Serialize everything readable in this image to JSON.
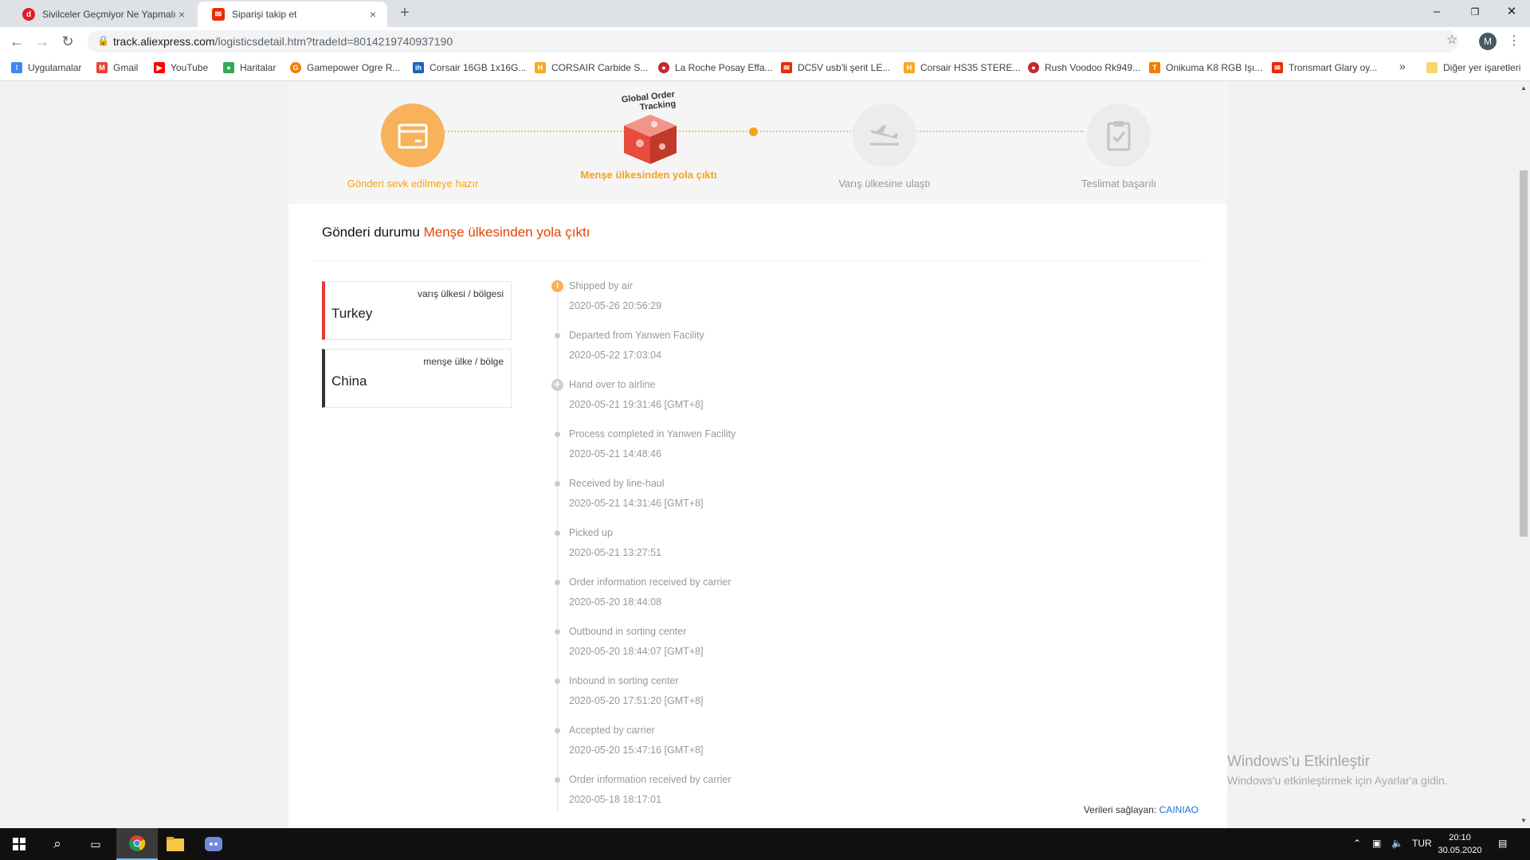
{
  "browser": {
    "tabs": [
      {
        "title": "Sivilceler Geçmiyor Ne Yapmalıyım",
        "close": "×",
        "favicon": "red-circle-icon",
        "color": "#e11c24"
      },
      {
        "title": "Siparişi takip et",
        "close": "×",
        "favicon": "aliexpress-icon",
        "color": "#e62e04"
      }
    ],
    "new_tab": "+",
    "window_controls": {
      "minimize": "–",
      "maximize": "❐",
      "close": "✕"
    },
    "url_host": "track.aliexpress.com",
    "url_path": "/logisticsdetail.htm?tradeId=8014219740937190",
    "profile_initial": "M",
    "bookmarks": [
      {
        "label": "Uygulamalar",
        "icon": "apps-grid-icon",
        "color": "#4285f4"
      },
      {
        "label": "Gmail",
        "icon": "gmail-icon",
        "color": "#ea4335"
      },
      {
        "label": "YouTube",
        "icon": "youtube-icon",
        "color": "#ff0000"
      },
      {
        "label": "Haritalar",
        "icon": "maps-pin-icon",
        "color": "#34a853"
      },
      {
        "label": "Gamepower Ogre R...",
        "icon": "gamepower-icon",
        "color": "#f57c00"
      },
      {
        "label": "Corsair 16GB 1x16G...",
        "icon": "ih-icon",
        "color": "#1565c0"
      },
      {
        "label": "CORSAIR Carbide S...",
        "icon": "hb-icon",
        "color": "#f9a825"
      },
      {
        "label": "La Roche Posay Effa...",
        "icon": "ladybug-icon",
        "color": "#c62828"
      },
      {
        "label": "DC5V usb'li şerit LE...",
        "icon": "aliexpress-icon",
        "color": "#e62e04"
      },
      {
        "label": "Corsair HS35 STERE...",
        "icon": "hb-icon",
        "color": "#f9a825"
      },
      {
        "label": "Rush Voodoo Rk949...",
        "icon": "ladybug-icon",
        "color": "#c62828"
      },
      {
        "label": "Onikuma K8 RGB Işı...",
        "icon": "t-icon",
        "color": "#f57c00"
      },
      {
        "label": "Tronsmart Glary oy...",
        "icon": "aliexpress-icon",
        "color": "#e62e04"
      }
    ],
    "bookmarks_more": "»",
    "other_bookmarks": "Diğer yer işaretleri"
  },
  "tracking": {
    "badge_line1": "Global Order",
    "badge_line2": "Tracking",
    "steps": [
      {
        "label": "Gönderi sevk edilmeye hazır",
        "icon": "package-icon",
        "state": "done"
      },
      {
        "label": "Menşe ülkesinden yola çıktı",
        "icon": "global-order-box-icon",
        "state": "current"
      },
      {
        "label": "Varış ülkesine ulaştı",
        "icon": "plane-landing-icon",
        "state": "pending"
      },
      {
        "label": "Teslimat başarılı",
        "icon": "clipboard-check-icon",
        "state": "pending"
      }
    ],
    "status_label": "Gönderi durumu",
    "status_value": "Menşe ülkesinden yola çıktı",
    "destination": {
      "label": "varış ülkesi / bölgesi",
      "country": "Turkey"
    },
    "origin": {
      "label": "menşe ülke / bölge",
      "country": "China"
    },
    "events": [
      {
        "desc": "Shipped by air",
        "time": "2020-05-26 20:56:29",
        "marker": "!"
      },
      {
        "desc": "Departed from Yanwen Facility",
        "time": "2020-05-22 17:03:04"
      },
      {
        "desc": "Hand over to airline",
        "time": "2020-05-21 19:31:46 [GMT+8]",
        "marker": "✈"
      },
      {
        "desc": "Process completed in Yanwen Facility",
        "time": "2020-05-21 14:48:46"
      },
      {
        "desc": "Received by line-haul",
        "time": "2020-05-21 14:31:46 [GMT+8]"
      },
      {
        "desc": "Picked up",
        "time": "2020-05-21 13:27:51"
      },
      {
        "desc": "Order information received by carrier",
        "time": "2020-05-20 18:44:08"
      },
      {
        "desc": "Outbound in sorting center",
        "time": "2020-05-20 18:44:07 [GMT+8]"
      },
      {
        "desc": "Inbound in sorting center",
        "time": "2020-05-20 17:51:20 [GMT+8]"
      },
      {
        "desc": "Accepted by carrier",
        "time": "2020-05-20 15:47:16 [GMT+8]"
      },
      {
        "desc": "Order information received by carrier",
        "time": "2020-05-18 18:17:01"
      }
    ],
    "provider_label": "Verileri sağlayan:",
    "provider_name": "CAINIAO",
    "colors": {
      "accent": "#f8a21a",
      "status": "#e64400",
      "destination_bar": "#e53935",
      "origin_bar": "#333333",
      "provider_link": "#1a73c8"
    }
  },
  "watermark": {
    "line1": "Windows'u Etkinleştir",
    "line2": "Windows'u etkinleştirmek için Ayarlar'a gidin."
  },
  "taskbar": {
    "apps": [
      "windows-start-icon",
      "search-icon",
      "task-view-icon",
      "chrome-icon",
      "file-explorer-icon",
      "discord-icon"
    ],
    "language": "TUR",
    "time": "20:10",
    "date": "30.05.2020"
  }
}
